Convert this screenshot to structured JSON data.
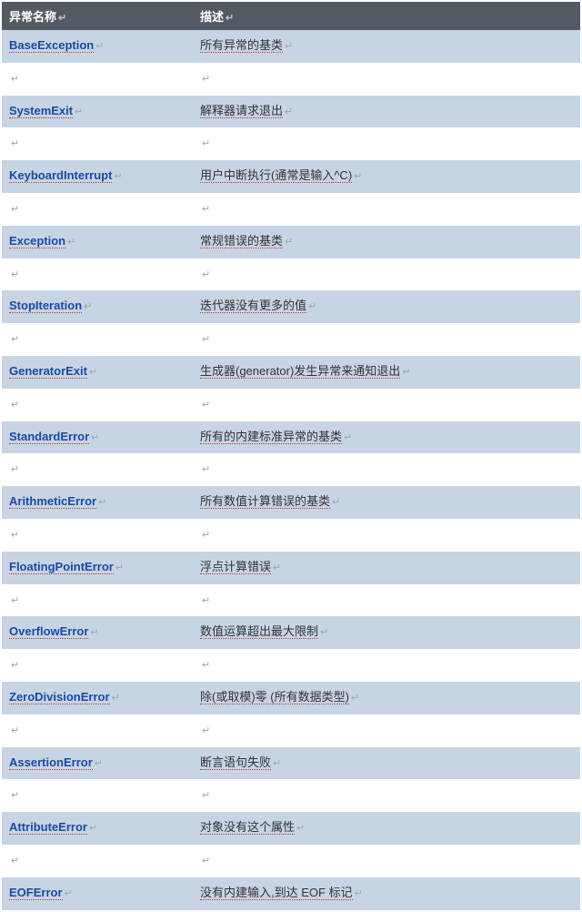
{
  "header": {
    "name": "异常名称",
    "desc": "描述"
  },
  "mark": "↵",
  "rows": [
    {
      "name": "BaseException",
      "desc": "所有异常的基类"
    },
    {
      "name": "SystemExit",
      "desc": "解释器请求退出"
    },
    {
      "name": "KeyboardInterrupt",
      "desc": "用户中断执行(通常是输入^C)"
    },
    {
      "name": "Exception",
      "desc": "常规错误的基类"
    },
    {
      "name": "StopIteration",
      "desc": "迭代器没有更多的值"
    },
    {
      "name": "GeneratorExit",
      "desc": "生成器(generator)发生异常来通知退出"
    },
    {
      "name": "StandardError",
      "desc": "所有的内建标准异常的基类"
    },
    {
      "name": "ArithmeticError",
      "desc": "所有数值计算错误的基类"
    },
    {
      "name": "FloatingPointError",
      "desc": "浮点计算错误"
    },
    {
      "name": "OverflowError",
      "desc": "数值运算超出最大限制"
    },
    {
      "name": "ZeroDivisionError",
      "desc": "除(或取模)零 (所有数据类型)"
    },
    {
      "name": "AssertionError",
      "desc": "断言语句失败"
    },
    {
      "name": "AttributeError",
      "desc": "对象没有这个属性"
    },
    {
      "name": "EOFError",
      "desc": "没有内建输入,到达 EOF 标记"
    }
  ]
}
